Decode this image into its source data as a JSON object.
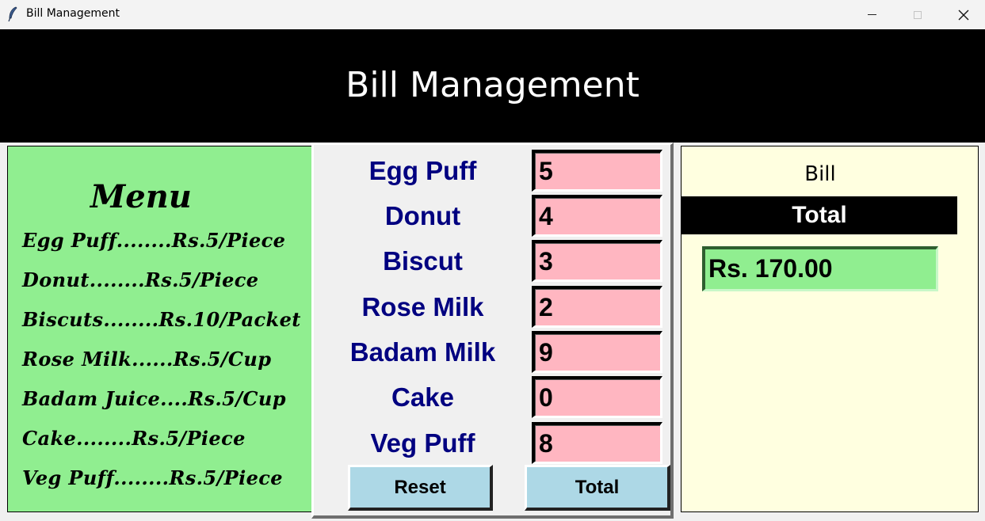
{
  "window": {
    "title": "Bill Management",
    "minimize_icon": "minimize-icon",
    "maximize_icon": "maximize-icon",
    "close_icon": "close-icon"
  },
  "header": {
    "title": "Bill Management"
  },
  "menu": {
    "title": "Menu",
    "items": [
      "Egg Puff........Rs.5/Piece",
      "Donut........Rs.5/Piece",
      "Biscuts........Rs.10/Packet",
      "Rose Milk......Rs.5/Cup",
      "Badam Juice....Rs.5/Cup",
      "Cake........Rs.5/Piece",
      "Veg Puff........Rs.5/Piece"
    ]
  },
  "order": {
    "items": [
      {
        "label": "Egg Puff",
        "qty": "5"
      },
      {
        "label": "Donut",
        "qty": "4"
      },
      {
        "label": "Biscut",
        "qty": "3"
      },
      {
        "label": "Rose Milk",
        "qty": "2"
      },
      {
        "label": "Badam Milk",
        "qty": "9"
      },
      {
        "label": "Cake",
        "qty": "0"
      },
      {
        "label": "Veg Puff",
        "qty": "8"
      }
    ],
    "reset_label": "Reset",
    "total_label": "Total"
  },
  "bill": {
    "label": "Bill",
    "total_header": "Total",
    "total_value": "Rs. 170.00"
  },
  "colors": {
    "menu_bg": "#90ee90",
    "input_bg": "#ffb6c1",
    "button_bg": "#add8e6",
    "bill_bg": "#ffffe0",
    "label_color": "#000080"
  }
}
